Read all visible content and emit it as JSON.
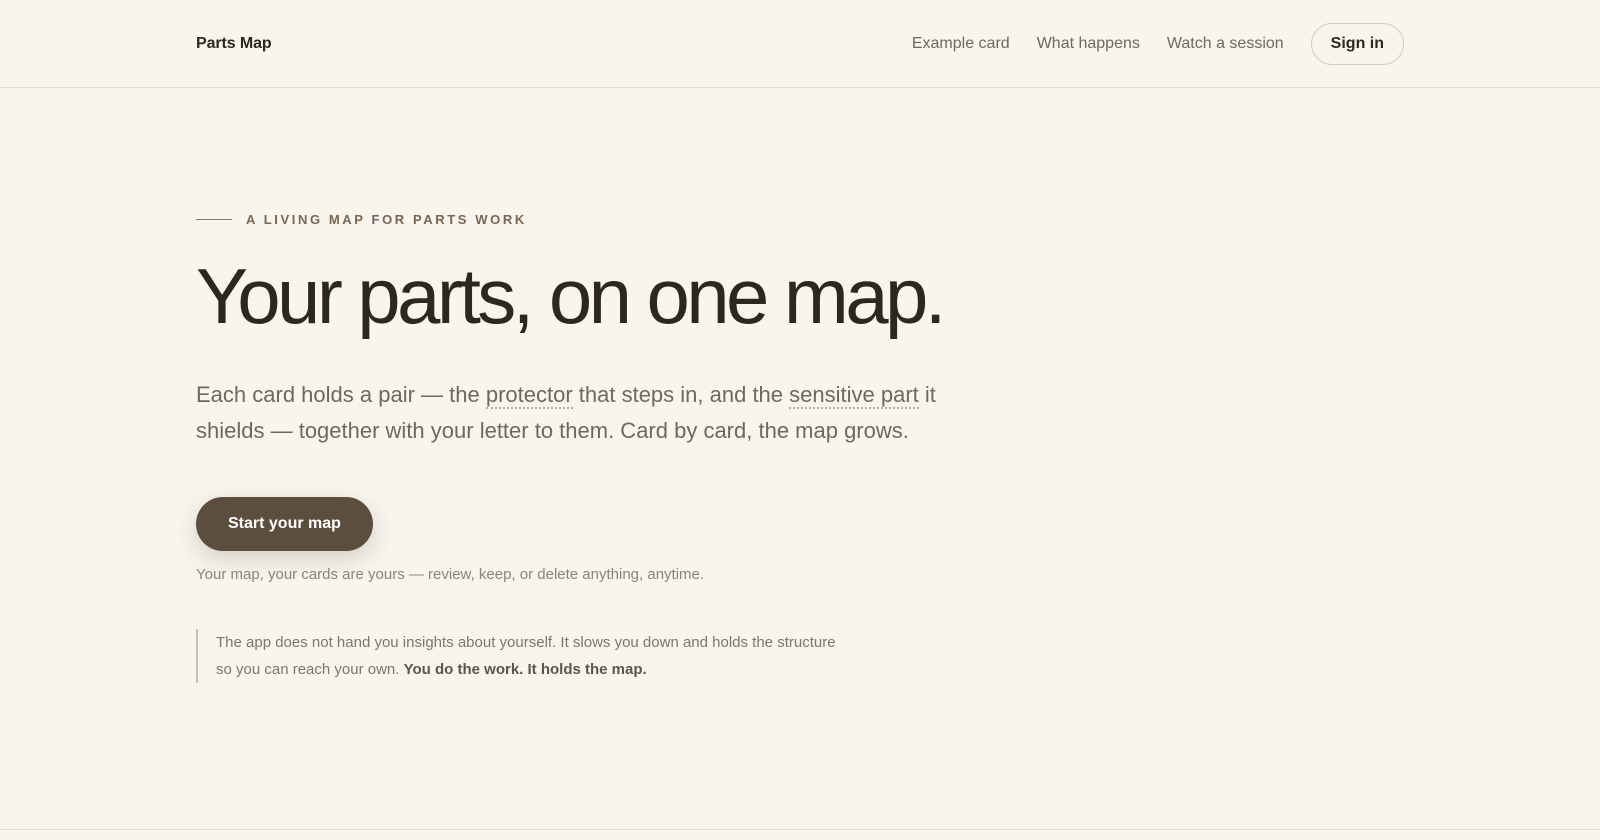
{
  "header": {
    "brand": "Parts Map",
    "nav": [
      "Example card",
      "What happens",
      "Watch a session"
    ],
    "signin_label": "Sign in"
  },
  "hero": {
    "eyebrow": "A LIVING MAP FOR PARTS WORK",
    "headline": "Your parts, on one map.",
    "lead": {
      "part1": "Each card holds a pair — the ",
      "term1": "protector",
      "part2": " that steps in, and the ",
      "term2": "sensitive part",
      "part3": " it shields — together with your letter to them. Card by card, the map grows."
    },
    "cta_label": "Start your map",
    "note": "Your map, your cards are yours — review, keep, or delete anything, anytime.",
    "quote": {
      "text": "The app does not hand you insights about yourself. It slows you down and holds the structure so you can reach your own. ",
      "emphasis": "You do the work. It holds the map."
    }
  },
  "colors": {
    "background": "#f8f4ee",
    "accent": "#5c4e3f",
    "text": "#2b2721"
  }
}
